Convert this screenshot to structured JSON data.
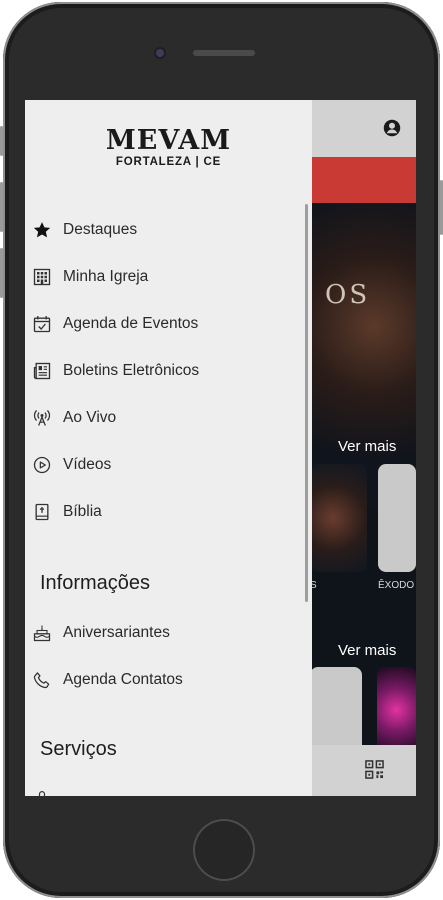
{
  "drawer": {
    "logo_main": "MEVAM",
    "logo_sub": "FORTALEZA | CE",
    "items": [
      {
        "label": "Destaques",
        "icon": "star-icon"
      },
      {
        "label": "Minha Igreja",
        "icon": "building-icon"
      },
      {
        "label": "Agenda de Eventos",
        "icon": "calendar-check-icon"
      },
      {
        "label": "Boletins Eletrônicos",
        "icon": "newspaper-icon"
      },
      {
        "label": "Ao Vivo",
        "icon": "broadcast-icon"
      },
      {
        "label": "Vídeos",
        "icon": "play-circle-icon"
      },
      {
        "label": "Bíblia",
        "icon": "bible-icon"
      }
    ],
    "section_info": "Informações",
    "info_items": [
      {
        "label": "Aniversariantes",
        "icon": "cake-icon"
      },
      {
        "label": "Agenda Contatos",
        "icon": "phone-icon"
      }
    ],
    "section_services": "Serviços"
  },
  "background": {
    "see_more_1": "Ver mais",
    "see_more_2": "Ver mais",
    "thumb_caption_1": "S",
    "thumb_caption_2": "ÊXODO",
    "hero_text": "OS"
  },
  "colors": {
    "accent_red": "#c83a33",
    "drawer_bg": "#eeeeee",
    "app_bg": "#0f141b"
  }
}
